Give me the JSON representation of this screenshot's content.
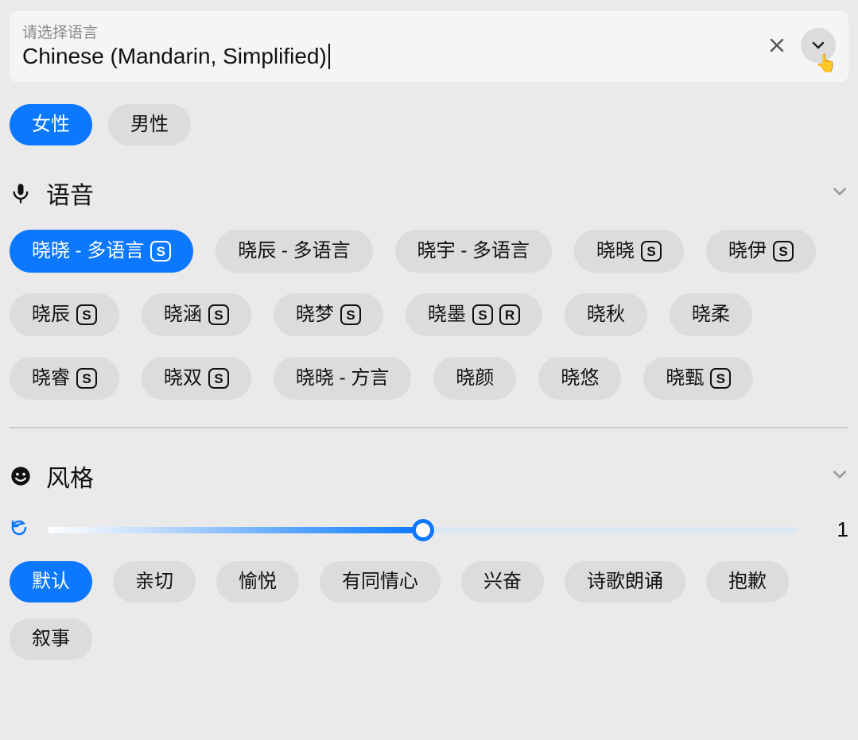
{
  "language": {
    "placeholder": "请选择语言",
    "value": "Chinese (Mandarin, Simplified)"
  },
  "gender": {
    "options": [
      {
        "label": "女性",
        "selected": true
      },
      {
        "label": "男性",
        "selected": false
      }
    ]
  },
  "voice_section": {
    "title": "语音",
    "items": [
      {
        "label": "晓晓 - 多语言",
        "badges": [
          "S"
        ],
        "selected": true
      },
      {
        "label": "晓辰 - 多语言",
        "badges": []
      },
      {
        "label": "晓宇 - 多语言",
        "badges": []
      },
      {
        "label": "晓晓",
        "badges": [
          "S"
        ]
      },
      {
        "label": "晓伊",
        "badges": [
          "S"
        ]
      },
      {
        "label": "晓辰",
        "badges": [
          "S"
        ]
      },
      {
        "label": "晓涵",
        "badges": [
          "S"
        ]
      },
      {
        "label": "晓梦",
        "badges": [
          "S"
        ]
      },
      {
        "label": "晓墨",
        "badges": [
          "S",
          "R"
        ]
      },
      {
        "label": "晓秋",
        "badges": []
      },
      {
        "label": "晓柔",
        "badges": []
      },
      {
        "label": "晓睿",
        "badges": [
          "S"
        ]
      },
      {
        "label": "晓双",
        "badges": [
          "S"
        ]
      },
      {
        "label": "晓晓 - 方言",
        "badges": []
      },
      {
        "label": "晓颜",
        "badges": []
      },
      {
        "label": "晓悠",
        "badges": []
      },
      {
        "label": "晓甄",
        "badges": [
          "S"
        ]
      }
    ]
  },
  "style_section": {
    "title": "风格",
    "slider_value": "1",
    "items": [
      {
        "label": "默认",
        "selected": true
      },
      {
        "label": "亲切"
      },
      {
        "label": "愉悦"
      },
      {
        "label": "有同情心"
      },
      {
        "label": "兴奋"
      },
      {
        "label": "诗歌朗诵"
      },
      {
        "label": "抱歉"
      },
      {
        "label": "叙事"
      }
    ]
  }
}
